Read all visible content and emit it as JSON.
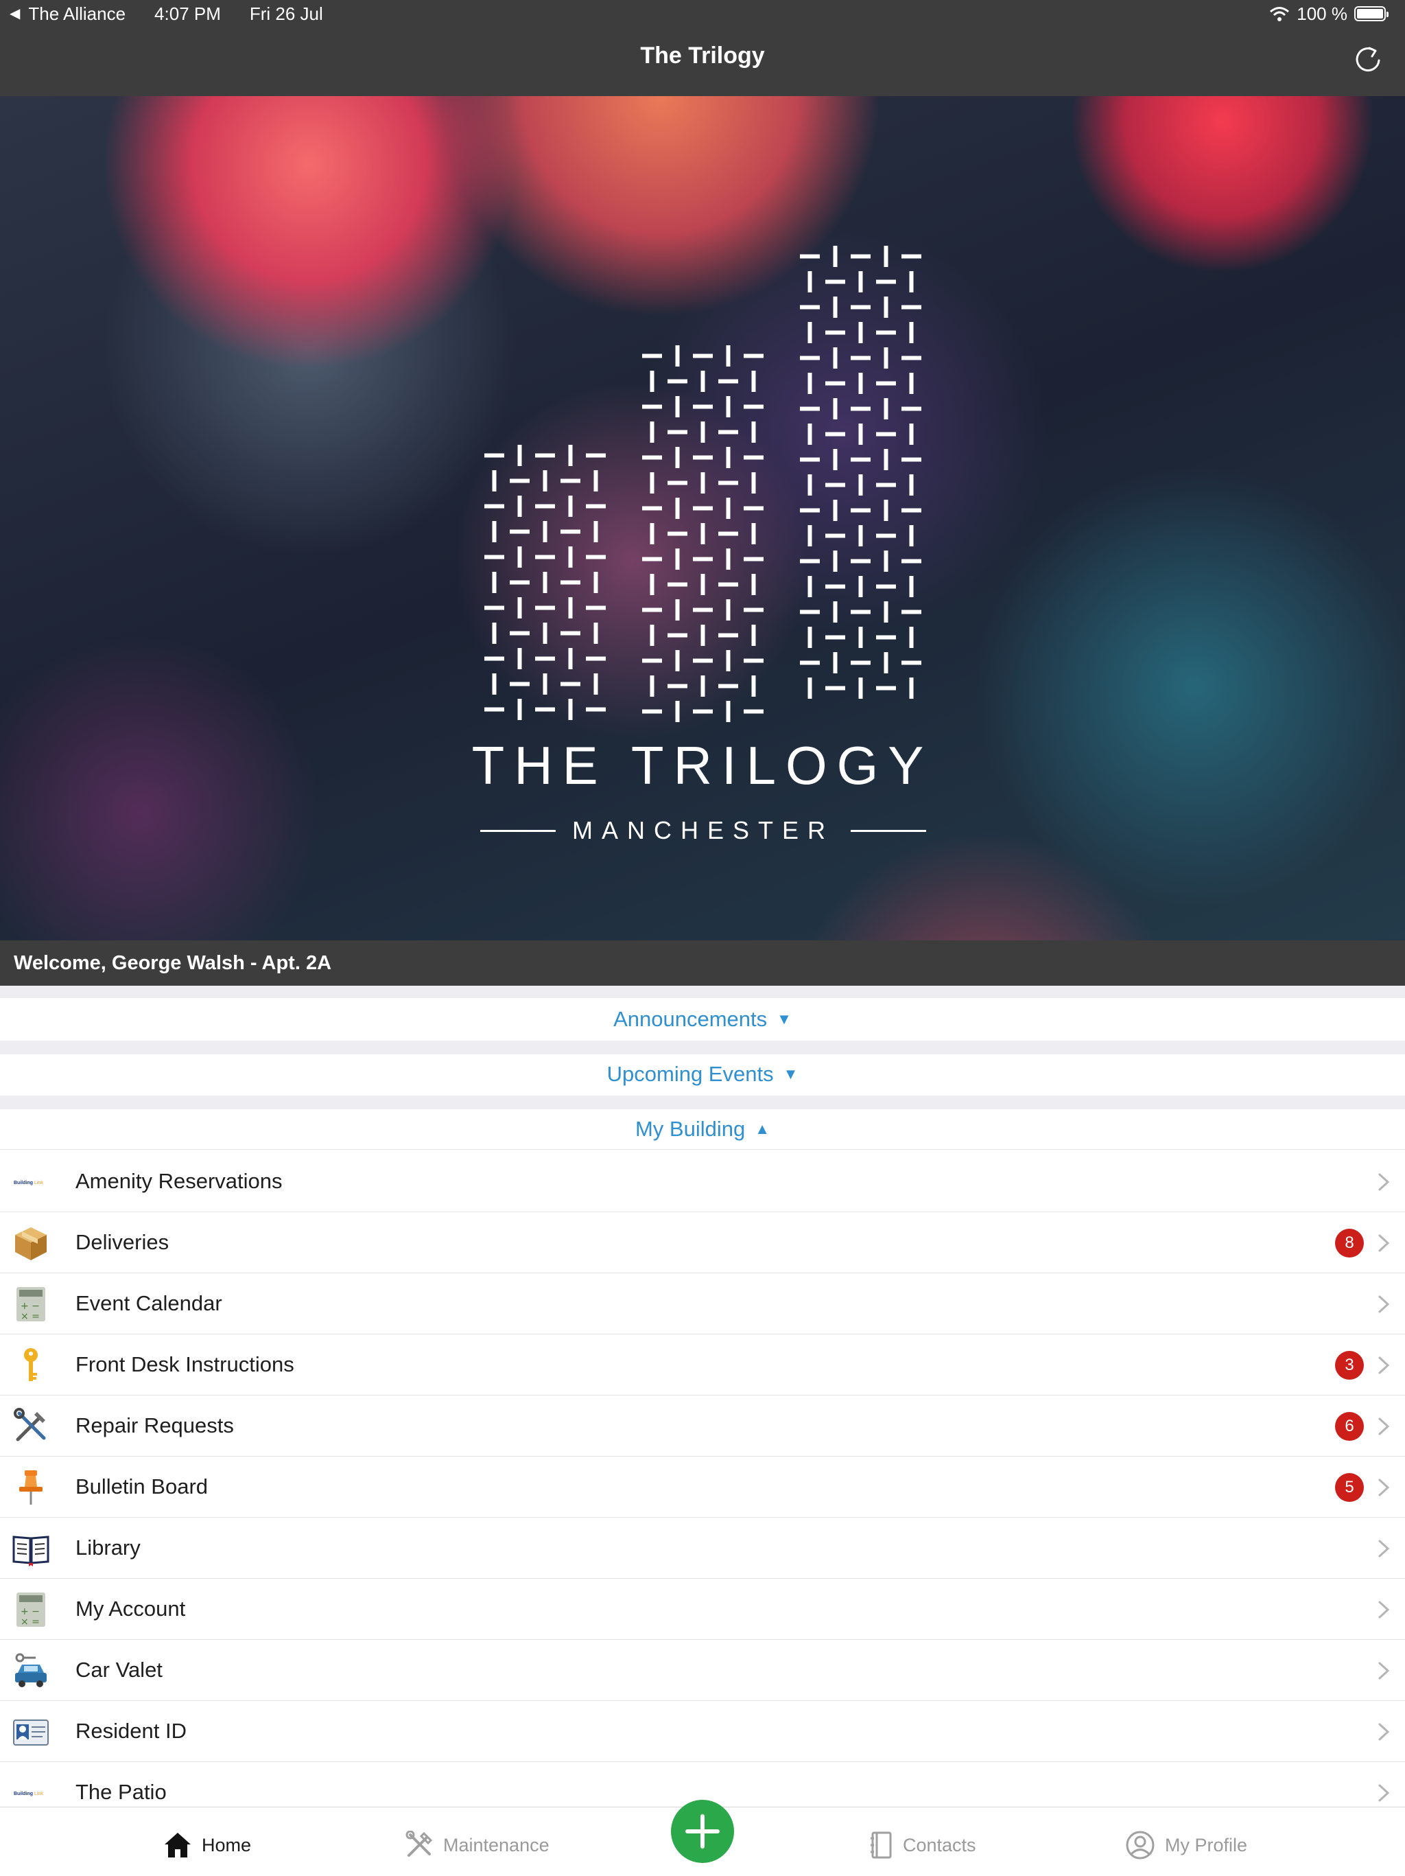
{
  "status_bar": {
    "back_app": "The Alliance",
    "time": "4:07 PM",
    "date": "Fri 26 Jul",
    "battery": "100 %"
  },
  "nav": {
    "title": "The Trilogy"
  },
  "hero": {
    "title": "THE TRILOGY",
    "subtitle": "MANCHESTER"
  },
  "welcome": "Welcome, George Walsh - Apt.  2A",
  "sections": {
    "announcements": "Announcements",
    "upcoming_events": "Upcoming Events",
    "my_building": "My Building"
  },
  "icons": {
    "collapsed_arrow": "▼",
    "expanded_arrow": "▲"
  },
  "building_items": [
    {
      "label": "Amenity Reservations",
      "icon": "buildinglink-logo-icon",
      "badge": ""
    },
    {
      "label": "Deliveries",
      "icon": "package-icon",
      "badge": "8"
    },
    {
      "label": "Event Calendar",
      "icon": "calculator-icon",
      "badge": ""
    },
    {
      "label": "Front Desk Instructions",
      "icon": "key-icon",
      "badge": "3"
    },
    {
      "label": "Repair Requests",
      "icon": "tools-icon",
      "badge": "6"
    },
    {
      "label": "Bulletin Board",
      "icon": "pushpin-icon",
      "badge": "5"
    },
    {
      "label": "Library",
      "icon": "book-icon",
      "badge": ""
    },
    {
      "label": "My Account",
      "icon": "calculator-icon",
      "badge": ""
    },
    {
      "label": "Car Valet",
      "icon": "car-key-icon",
      "badge": ""
    },
    {
      "label": "Resident ID",
      "icon": "id-card-icon",
      "badge": ""
    },
    {
      "label": "The Patio",
      "icon": "buildinglink-logo-icon",
      "badge": ""
    }
  ],
  "tabs": {
    "home": "Home",
    "maintenance": "Maintenance",
    "contacts": "Contacts",
    "my_profile": "My Profile"
  },
  "colors": {
    "accent_blue": "#2f8fd1",
    "badge_red": "#cc1f1a",
    "fab_green": "#2aa84a",
    "bar_dark": "#3d3d3d"
  }
}
